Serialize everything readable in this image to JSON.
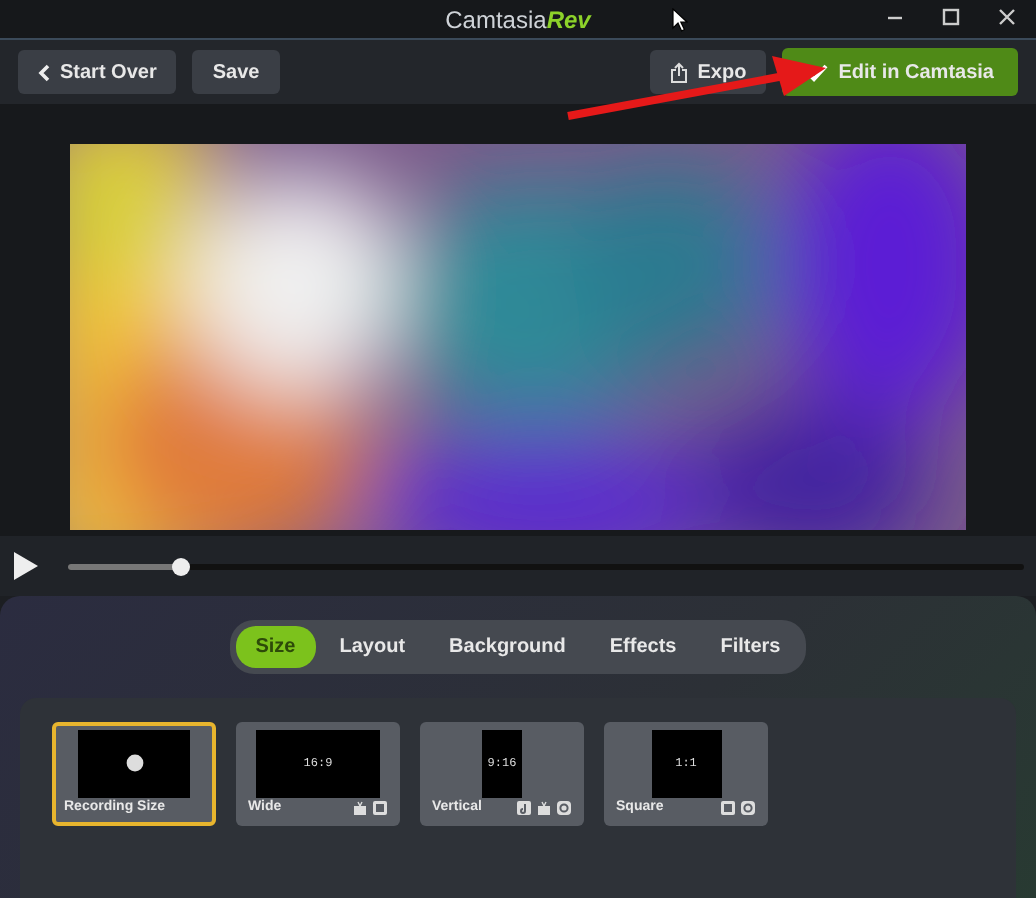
{
  "window": {
    "title": "Camtasia",
    "title_accent": "Rev"
  },
  "toolbar": {
    "start_over": "Start Over",
    "save": "Save",
    "export": "Expo",
    "edit": "Edit in Camtasia"
  },
  "player": {
    "level": 0.12
  },
  "tabs": [
    {
      "label": "Size",
      "selected": true
    },
    {
      "label": "Layout",
      "selected": false
    },
    {
      "label": "Background",
      "selected": false
    },
    {
      "label": "Effects",
      "selected": false
    },
    {
      "label": "Filters",
      "selected": false
    }
  ],
  "presets": [
    {
      "label": "Recording Size",
      "kind": "dot",
      "selected": true
    },
    {
      "label": "Wide",
      "kind": "wide",
      "ratio": "16:9",
      "selected": false,
      "icons": [
        {
          "kind": "tube"
        },
        {
          "kind": "box"
        }
      ]
    },
    {
      "label": "Vertical",
      "kind": "tall",
      "ratio": "9:16",
      "selected": false,
      "icons": [
        {
          "kind": "note"
        },
        {
          "kind": "tube"
        },
        {
          "kind": "ring"
        }
      ]
    },
    {
      "label": "Square",
      "kind": "square",
      "ratio": "1:1",
      "selected": false,
      "icons": [
        {
          "kind": "box"
        },
        {
          "kind": "ring"
        }
      ]
    }
  ]
}
